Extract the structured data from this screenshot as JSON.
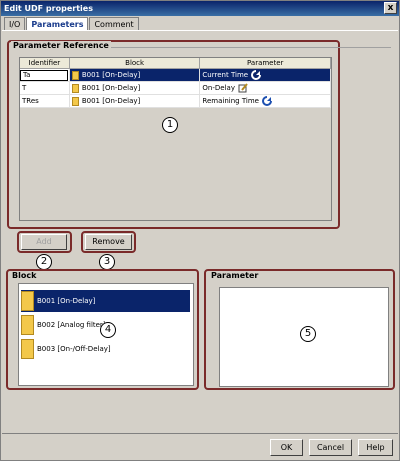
{
  "window": {
    "title": "Edit UDF properties",
    "close_glyph": "x"
  },
  "tabs": [
    {
      "label": "I/O"
    },
    {
      "label": "Parameters"
    },
    {
      "label": "Comment"
    }
  ],
  "param_ref": {
    "label": "Parameter Reference",
    "columns": [
      "Identifier",
      "Block",
      "Parameter"
    ],
    "rows": [
      {
        "identifier": "Ta",
        "block": "B001 [On-Delay]",
        "parameter": "Current Time",
        "icon": "refresh-icon"
      },
      {
        "identifier": "T",
        "block": "B001 [On-Delay]",
        "parameter": "On-Delay",
        "icon": "edit-icon"
      },
      {
        "identifier": "TRes",
        "block": "B001 [On-Delay]",
        "parameter": "Remaining Time",
        "icon": "refresh-icon"
      }
    ]
  },
  "buttons": {
    "add": "Add",
    "remove": "Remove",
    "ok": "OK",
    "cancel": "Cancel",
    "help": "Help"
  },
  "block_group": {
    "label": "Block",
    "items": [
      {
        "label": "B001 [On-Delay]"
      },
      {
        "label": "B002 [Analog filter]"
      },
      {
        "label": "B003 [On-/Off-Delay]"
      }
    ]
  },
  "parameter_group": {
    "label": "Parameter"
  },
  "callouts": [
    "1",
    "2",
    "3",
    "4",
    "5"
  ]
}
